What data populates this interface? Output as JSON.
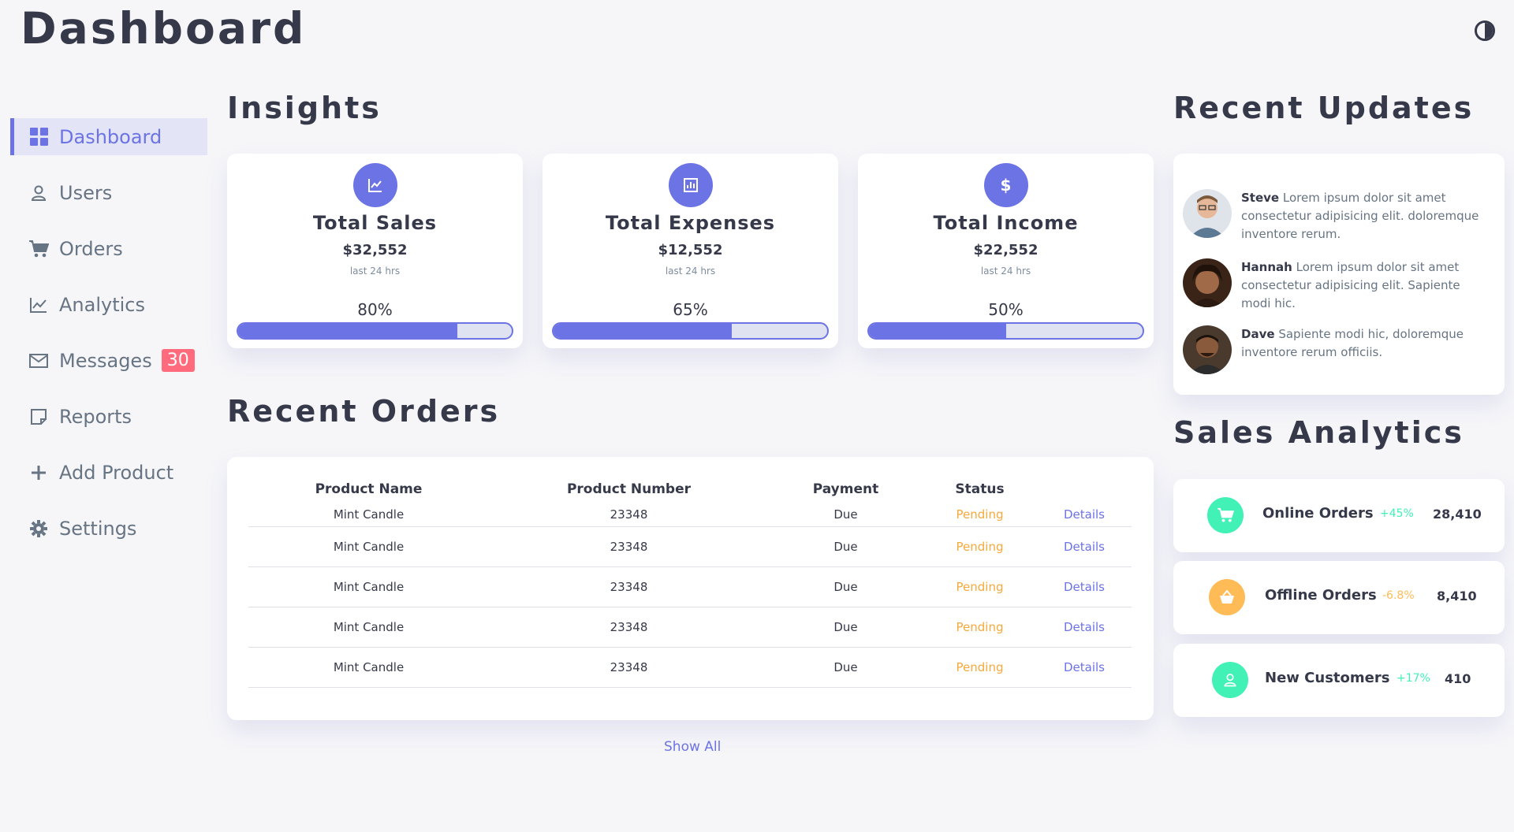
{
  "header": {
    "title": "Dashboard"
  },
  "sidebar": {
    "items": [
      {
        "label": "Dashboard",
        "icon": "grid-icon"
      },
      {
        "label": "Users",
        "icon": "user-icon"
      },
      {
        "label": "Orders",
        "icon": "cart-icon"
      },
      {
        "label": "Analytics",
        "icon": "chart-icon"
      },
      {
        "label": "Messages",
        "icon": "mail-icon",
        "badge": "30"
      },
      {
        "label": "Reports",
        "icon": "note-icon"
      },
      {
        "label": "Add Product",
        "icon": "plus-icon"
      },
      {
        "label": "Settings",
        "icon": "gear-icon"
      }
    ]
  },
  "insights": {
    "heading": "Insights",
    "cards": [
      {
        "title": "Total Sales",
        "amount": "$32,552",
        "sub": "last 24 hrs",
        "percent_label": "80%",
        "progress": 0.8
      },
      {
        "title": "Total Expenses",
        "amount": "$12,552",
        "sub": "last 24 hrs",
        "percent_label": "65%",
        "progress": 0.65
      },
      {
        "title": "Total Income",
        "amount": "$22,552",
        "sub": "last 24 hrs",
        "percent_label": "50%",
        "progress": 0.5
      }
    ]
  },
  "orders": {
    "heading": "Recent Orders",
    "columns": [
      "Product Name",
      "Product Number",
      "Payment",
      "Status"
    ],
    "rows": [
      {
        "name": "Mint Candle",
        "number": "23348",
        "payment": "Due",
        "status": "Pending",
        "action": "Details"
      },
      {
        "name": "Mint Candle",
        "number": "23348",
        "payment": "Due",
        "status": "Pending",
        "action": "Details"
      },
      {
        "name": "Mint Candle",
        "number": "23348",
        "payment": "Due",
        "status": "Pending",
        "action": "Details"
      },
      {
        "name": "Mint Candle",
        "number": "23348",
        "payment": "Due",
        "status": "Pending",
        "action": "Details"
      },
      {
        "name": "Mint Candle",
        "number": "23348",
        "payment": "Due",
        "status": "Pending",
        "action": "Details"
      }
    ],
    "show_all": "Show All"
  },
  "updates": {
    "heading": "Recent Updates",
    "items": [
      {
        "name": "Steve",
        "text": "Lorem ipsum dolor sit amet consectetur adipisicing elit. doloremque inventore rerum."
      },
      {
        "name": "Hannah",
        "text": "Lorem ipsum dolor sit amet consectetur adipisicing elit. Sapiente modi hic."
      },
      {
        "name": "Dave",
        "text": "Sapiente modi hic, doloremque inventore rerum officiis."
      }
    ]
  },
  "analytics": {
    "heading": "Sales Analytics",
    "items": [
      {
        "label": "Online Orders",
        "percent": "+45%",
        "value": "28,410",
        "color": "#41f1b6",
        "icon": "cart-icon"
      },
      {
        "label": "Offline Orders",
        "percent": "-6.8%",
        "value": "8,410",
        "color": "#ffbb55",
        "icon": "basket-icon"
      },
      {
        "label": "New Customers",
        "percent": "+17%",
        "value": "410",
        "color": "#41f1b6",
        "icon": "user-icon"
      }
    ]
  },
  "colors": {
    "primary": "#6c73e5",
    "success": "#41f1b6",
    "warning": "#ffbb55",
    "danger": "#ff6b7d",
    "pending": "#f7a93b"
  }
}
